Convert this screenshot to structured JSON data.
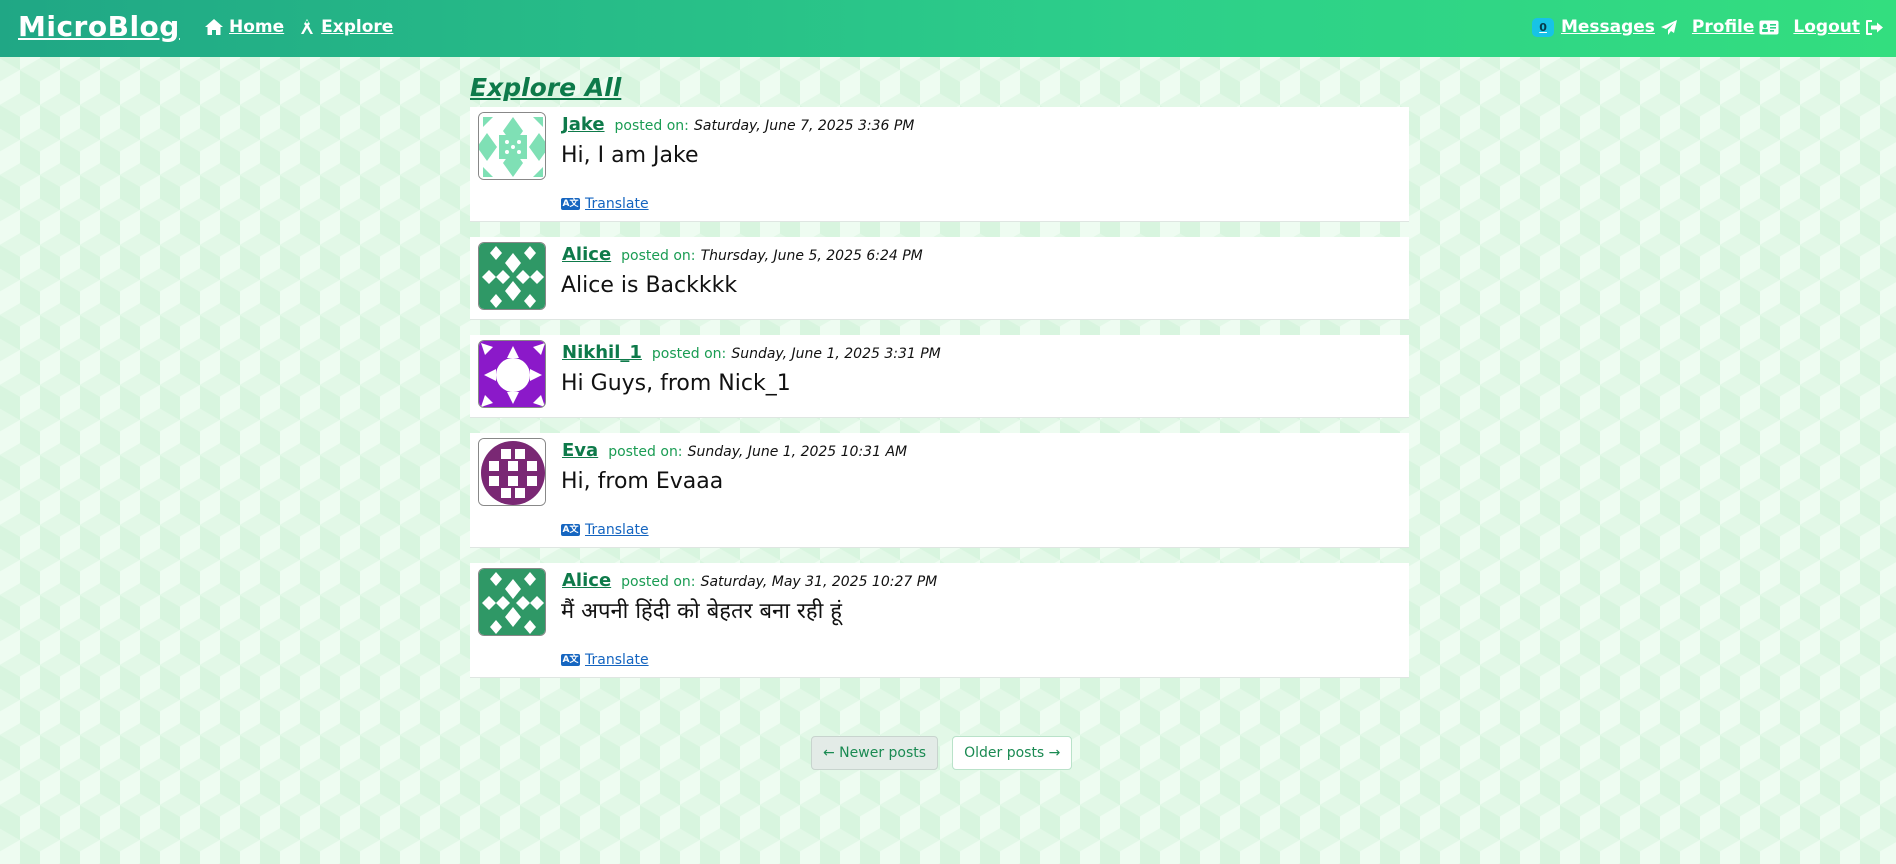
{
  "nav": {
    "brand": "MicroBlog",
    "home": "Home",
    "explore": "Explore",
    "messages_count": "0",
    "messages": "Messages",
    "profile": "Profile",
    "logout": "Logout"
  },
  "main": {
    "title": "Explore All",
    "posted_label": "posted on:",
    "translate_label": "Translate",
    "posts": [
      {
        "author": "Jake",
        "date": "Saturday, June 7, 2025 3:36 PM",
        "body": "Hi, I am Jake",
        "translate": true,
        "avatar_colors": [
          "#7fe0b5",
          "#ffffff"
        ]
      },
      {
        "author": "Alice",
        "date": "Thursday, June 5, 2025 6:24 PM",
        "body": "Alice is Backkkk",
        "translate": false,
        "avatar_colors": [
          "#2f9866",
          "#ffffff"
        ]
      },
      {
        "author": "Nikhil_1",
        "date": "Sunday, June 1, 2025 3:31 PM",
        "body": "Hi Guys, from Nick_1",
        "translate": false,
        "avatar_colors": [
          "#8b19c9",
          "#ffffff"
        ]
      },
      {
        "author": "Eva",
        "date": "Sunday, June 1, 2025 10:31 AM",
        "body": "Hi, from Evaaa",
        "translate": true,
        "avatar_colors": [
          "#7a2874",
          "#ffffff"
        ]
      },
      {
        "author": "Alice",
        "date": "Saturday, May 31, 2025 10:27 PM",
        "body": "मैं अपनी हिंदी को बेहतर बना रही हूं",
        "translate": true,
        "avatar_colors": [
          "#2f9866",
          "#ffffff"
        ]
      }
    ]
  },
  "pager": {
    "newer": "← Newer posts",
    "older": "Older posts →"
  },
  "colors": {
    "nav_gradient_start": "#20a785",
    "nav_gradient_end": "#33de7f",
    "accent": "#0e7a4a",
    "link": "#1565c0"
  }
}
